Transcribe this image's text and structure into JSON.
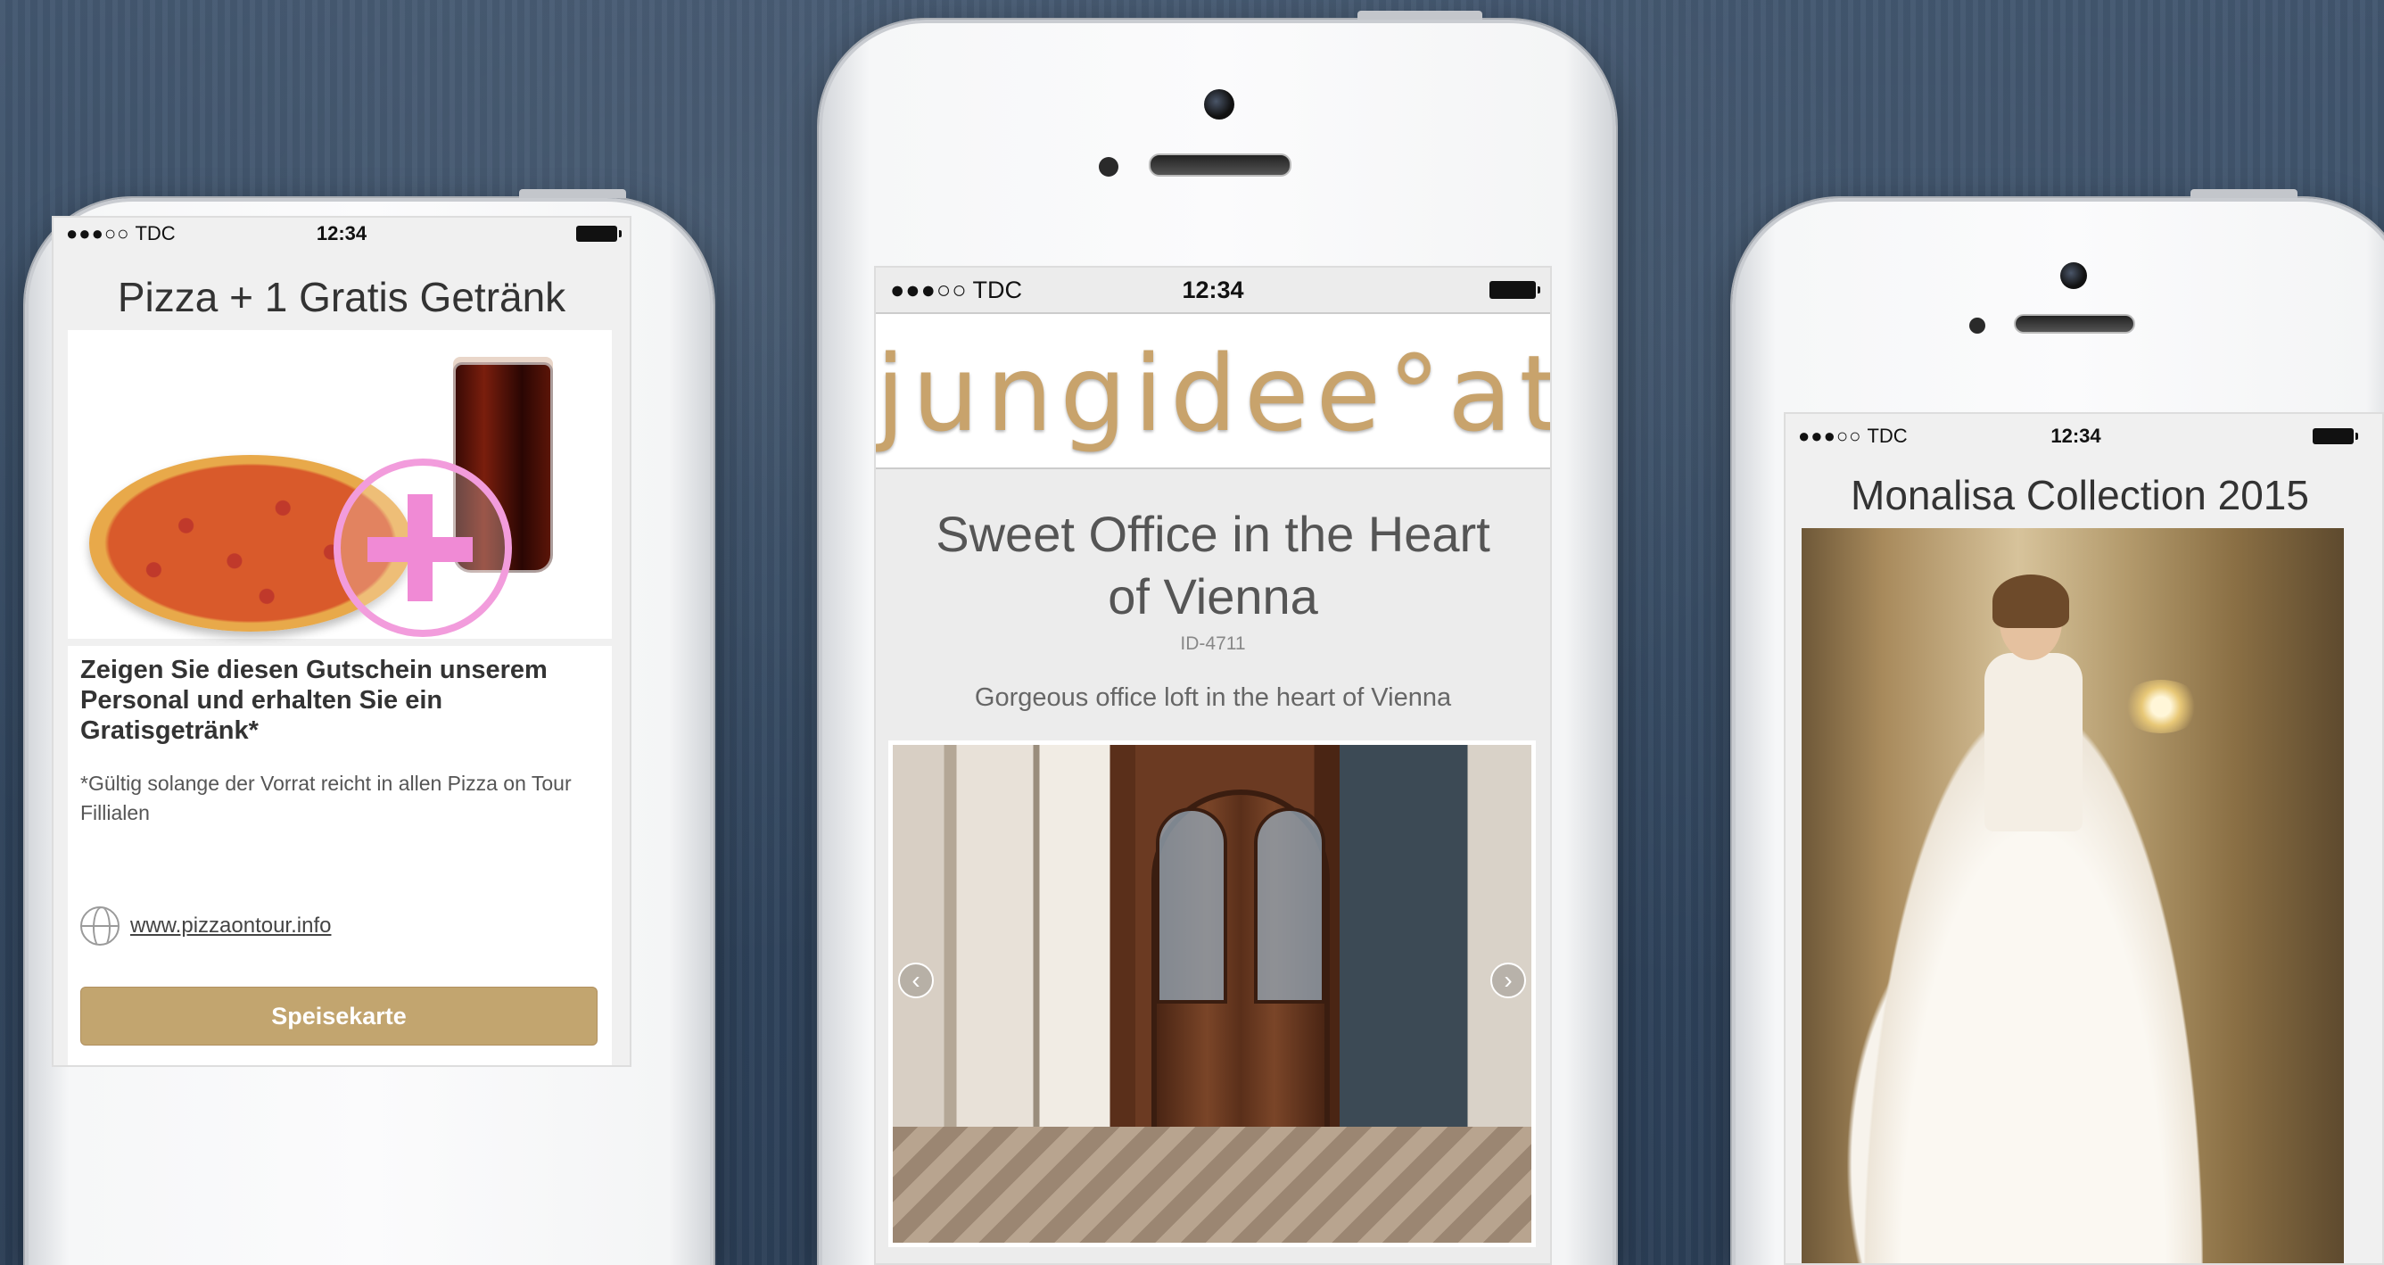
{
  "phones": {
    "left": {
      "status": {
        "signal": "●●●○○",
        "carrier": "TDC",
        "time": "12:34"
      },
      "offer": {
        "title": "Pizza + 1 Gratis Getränk",
        "headline": "Zeigen Sie diesen Gutschein unserem Personal und erhalten Sie ein Gratisgetränk*",
        "note": "*Gültig solange der Vorrat reicht in allen Pizza on Tour Fillialen",
        "website": "www.pizzaontour.info",
        "button_label": "Speisekarte"
      }
    },
    "center": {
      "status": {
        "signal": "●●●○○",
        "carrier": "TDC",
        "time": "12:34"
      },
      "brand": "jungidee°at",
      "listing": {
        "title": "Sweet Office in the Heart of Vienna",
        "id": "ID-4711",
        "description": "Gorgeous office loft in the heart of Vienna"
      },
      "gallery": {
        "prev_icon": "‹",
        "next_icon": "›"
      }
    },
    "right": {
      "status": {
        "signal": "●●●○○",
        "carrier": "TDC",
        "time": "12:34"
      },
      "collection_title": "Monalisa Collection 2015"
    }
  },
  "colors": {
    "background": "#34475f",
    "accent_gold": "#c2a56f",
    "plus_pink": "#f08ad5"
  }
}
